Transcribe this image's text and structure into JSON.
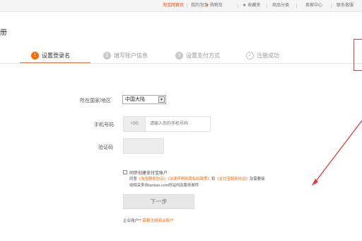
{
  "topbar": {
    "items": [
      {
        "label": "淘宝网首页"
      },
      {
        "label": "我的淘宝"
      },
      {
        "label": "购物车"
      },
      {
        "label": "收藏夹"
      },
      {
        "label": "商品分类"
      },
      {
        "label": "卖家中心"
      },
      {
        "label": "联系客服"
      }
    ]
  },
  "page": {
    "title": "册"
  },
  "steps": [
    {
      "num": "1",
      "label": "设置登录名"
    },
    {
      "num": "2",
      "label": "填写账户信息"
    },
    {
      "num": "3",
      "label": "设置支付方式"
    },
    {
      "num": "✓",
      "label": "注册成功"
    }
  ],
  "form": {
    "country_label": "所在国家/地区",
    "country_value": "中国大陆",
    "phone_label": "手机号码",
    "phone_prefix": "+86",
    "phone_placeholder": "请输入你的手机号码",
    "code_label": "验证码",
    "agree_title": "同步创建支付宝账户",
    "agree_line1_prefix": "同意",
    "agree_link1": "《淘宝服务协议》",
    "agree_link2": "《法律声明和隐私权政策》",
    "agree_and": "和",
    "agree_link3": "《支付宝服务协议》",
    "agree_line1_suffix": "及需要接",
    "agree_line2": "收相关来自taobao.com的站内及服务邮件",
    "next_label": "下一步",
    "enterprise_label": "企业账户?",
    "enterprise_link": "需要注册商业账户"
  },
  "colors": {
    "accent": "#ff6a00",
    "annotation": "#e23b3b"
  }
}
